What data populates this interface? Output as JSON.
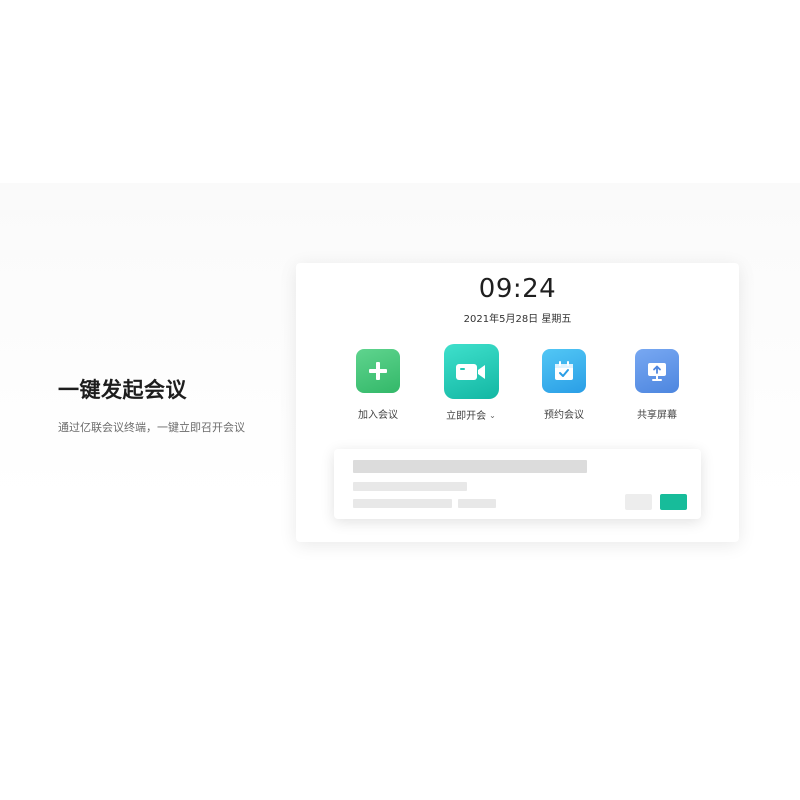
{
  "hero": {
    "title": "一键发起会议",
    "subtitle": "通过亿联会议终端，一键立即召开会议"
  },
  "app": {
    "time": "09:24",
    "date": "2021年5月28日  星期五",
    "actions": [
      {
        "label": "加入会议",
        "icon": "plus-icon",
        "color": "#3cc274"
      },
      {
        "label": "立即开会",
        "icon": "video-camera-icon",
        "color": "#22c9b4",
        "has_dropdown": true
      },
      {
        "label": "预约会议",
        "icon": "calendar-check-icon",
        "color": "#3aaef0"
      },
      {
        "label": "共享屏幕",
        "icon": "share-screen-icon",
        "color": "#5f95e8"
      }
    ],
    "dropdown_glyph": "⌄"
  },
  "colors": {
    "accent": "#17bc9a",
    "placeholder_dark": "#dcdcdc",
    "placeholder_light": "#e8e8e8"
  }
}
